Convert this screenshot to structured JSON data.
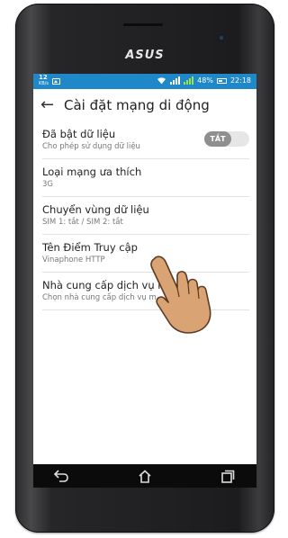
{
  "device": {
    "brand": "ASUS"
  },
  "status_bar": {
    "speed_value": "12",
    "speed_unit": "KB/s",
    "battery": "48%",
    "time": "22:18",
    "icons": [
      "speed-indicator",
      "image-notification-icon",
      "wifi-icon",
      "signal-icon",
      "sim2-signal-icon",
      "battery-icon"
    ]
  },
  "app_bar": {
    "back_icon": "arrow-left-icon",
    "title": "Cài đặt mạng di động"
  },
  "settings": [
    {
      "title": "Đã bật dữ liệu",
      "subtitle": "Cho phép sử dụng dữ liệu",
      "toggle": "TẮT"
    },
    {
      "title": "Loại mạng ưa thích",
      "subtitle": "3G"
    },
    {
      "title": "Chuyển vùng dữ liệu",
      "subtitle": "SIM 1: tắt / SIM 2: tắt"
    },
    {
      "title": "Tên Điểm Truy cập",
      "subtitle": "Vinaphone HTTP"
    },
    {
      "title": "Nhà cung cấp dịch vụ m",
      "subtitle": "Chọn nhà cung cấp dịch vụ m"
    }
  ],
  "overlay": {
    "icon": "pointing-hand-icon"
  },
  "nav_bar": {
    "icons": [
      "back-nav-icon",
      "home-nav-icon",
      "recent-apps-icon"
    ]
  },
  "colors": {
    "status_bar": "#1e88c9",
    "toggle_off": "#8f8f8f",
    "phone_body": "#1c1c1e"
  }
}
